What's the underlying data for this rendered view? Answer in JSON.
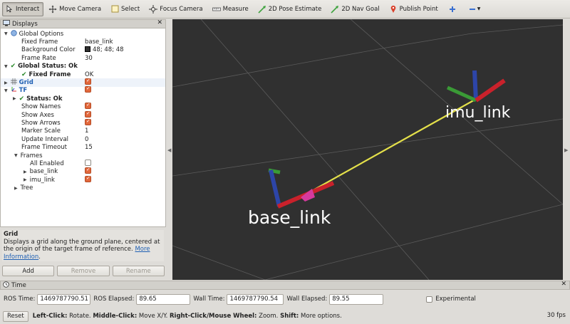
{
  "toolbar": {
    "items": [
      {
        "label": "Interact",
        "icon": "interact-icon"
      },
      {
        "label": "Move Camera",
        "icon": "move-camera-icon"
      },
      {
        "label": "Select",
        "icon": "select-icon"
      },
      {
        "label": "Focus Camera",
        "icon": "focus-camera-icon"
      },
      {
        "label": "Measure",
        "icon": "measure-icon"
      },
      {
        "label": "2D Pose Estimate",
        "icon": "pose-arrow-icon"
      },
      {
        "label": "2D Nav Goal",
        "icon": "nav-goal-icon"
      },
      {
        "label": "Publish Point",
        "icon": "map-pin-icon"
      }
    ]
  },
  "displays": {
    "title": "Displays",
    "global_options": "Global Options",
    "fixed_frame_label": "Fixed Frame",
    "fixed_frame_value": "base_link",
    "background_color_label": "Background Color",
    "background_color_value": "48; 48; 48",
    "background_color_hex": "#303030",
    "frame_rate_label": "Frame Rate",
    "frame_rate_value": "30",
    "global_status": "Global Status: Ok",
    "gs_fixed_frame_label": "Fixed Frame",
    "gs_fixed_frame_value": "OK",
    "grid_label": "Grid",
    "tf_label": "TF",
    "tf_status": "Status: Ok",
    "show_names": "Show Names",
    "show_axes": "Show Axes",
    "show_arrows": "Show Arrows",
    "marker_scale_label": "Marker Scale",
    "marker_scale_value": "1",
    "update_interval_label": "Update Interval",
    "update_interval_value": "0",
    "frame_timeout_label": "Frame Timeout",
    "frame_timeout_value": "15",
    "frames_label": "Frames",
    "all_enabled_label": "All Enabled",
    "frame_base_link": "base_link",
    "frame_imu_link": "imu_link",
    "tree_label": "Tree"
  },
  "description": {
    "title": "Grid",
    "text": "Displays a grid along the ground plane, centered at the origin of the target frame of reference. ",
    "link": "More Information",
    "link_suffix": "."
  },
  "panel_buttons": {
    "add": "Add",
    "remove": "Remove",
    "rename": "Rename"
  },
  "viewport": {
    "background": "#303030",
    "label_base": "base_link",
    "label_imu": "imu_link"
  },
  "time": {
    "title": "Time",
    "ros_time_label": "ROS Time:",
    "ros_time_value": "1469787790.51",
    "ros_elapsed_label": "ROS Elapsed:",
    "ros_elapsed_value": "89.65",
    "wall_time_label": "Wall Time:",
    "wall_time_value": "1469787790.54",
    "wall_elapsed_label": "Wall Elapsed:",
    "wall_elapsed_value": "89.55",
    "experimental_label": "Experimental"
  },
  "status": {
    "reset": "Reset",
    "left_click_bold": "Left-Click:",
    "left_click_text": " Rotate. ",
    "middle_click_bold": "Middle-Click:",
    "middle_click_text": " Move X/Y. ",
    "right_click_bold": "Right-Click/Mouse Wheel:",
    "right_click_text": " Zoom. ",
    "shift_bold": "Shift:",
    "shift_text": " More options.",
    "fps": "30 fps"
  }
}
